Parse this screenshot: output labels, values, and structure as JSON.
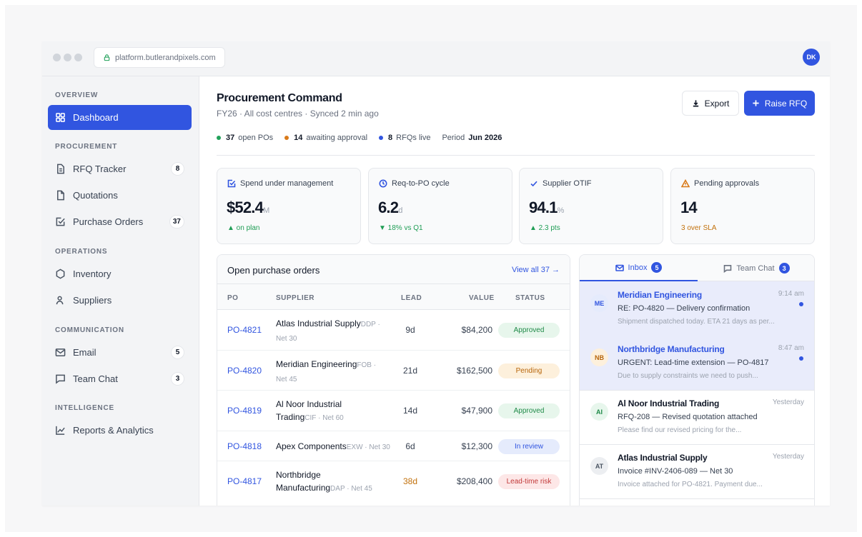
{
  "browser": {
    "url": "platform.butlerandpixels.com",
    "user_initials": "DK"
  },
  "sidebar": {
    "sections": {
      "overview": "OVERVIEW",
      "procurement": "PROCUREMENT",
      "operations": "OPERATIONS",
      "communication": "COMMUNICATION",
      "intelligence": "INTELLIGENCE"
    },
    "items": [
      {
        "label": "Dashboard",
        "icon": "grid-icon",
        "active": true
      },
      {
        "label": "RFQ Tracker",
        "icon": "file-list-icon",
        "badge": "8"
      },
      {
        "label": "Quotations",
        "icon": "document-icon"
      },
      {
        "label": "Purchase Orders",
        "icon": "checkbox-icon",
        "badge": "37"
      },
      {
        "label": "Inventory",
        "icon": "hexagon-icon"
      },
      {
        "label": "Suppliers",
        "icon": "user-icon"
      },
      {
        "label": "Email",
        "icon": "mail-icon",
        "badge": "5"
      },
      {
        "label": "Team Chat",
        "icon": "chat-icon",
        "badge": "3"
      },
      {
        "label": "Reports & Analytics",
        "icon": "chart-line-icon"
      }
    ]
  },
  "header": {
    "title": "Procurement Command",
    "subtitle": "FY26 · All cost centres · Synced 2 min ago",
    "export_label": "Export",
    "raise_rfq_label": "Raise RFQ"
  },
  "stats": {
    "open_pos": {
      "value": "37",
      "label": "open POs",
      "color": "#22a15a"
    },
    "awaiting": {
      "value": "14",
      "label": "awaiting approval",
      "color": "#d97a1a"
    },
    "rfqs": {
      "value": "8",
      "label": "RFQs live",
      "color": "#3155e0"
    },
    "period_label": "Period",
    "period_value": "Jun 2026"
  },
  "kpis": [
    {
      "label": "Spend under management",
      "value": "$52.4",
      "unit": "M",
      "delta": "▲ on plan",
      "delta_color": "#1f9d55",
      "icon": "checkbox-icon"
    },
    {
      "label": "Req-to-PO cycle",
      "value": "6.2",
      "unit": "d",
      "delta": "▼ 18% vs Q1",
      "delta_color": "#1f9d55",
      "icon": "clock-icon"
    },
    {
      "label": "Supplier OTIF",
      "value": "94.1",
      "unit": "%",
      "delta": "▲ 2.3 pts",
      "delta_color": "#1f9d55",
      "icon": "check-icon"
    },
    {
      "label": "Pending approvals",
      "value": "14",
      "unit": "",
      "delta": "3 over SLA",
      "delta_color": "#c2710c",
      "icon": "warning-icon"
    }
  ],
  "purchase_orders": {
    "title": "Open purchase orders",
    "view_all": "View all 37 →",
    "columns": [
      "PO",
      "SUPPLIER",
      "LEAD",
      "VALUE",
      "STATUS"
    ],
    "rows": [
      {
        "id": "PO-4821",
        "supplier": "Atlas Industrial Supply",
        "terms": "DDP · Net 30",
        "lead": "9d",
        "value": "$84,200",
        "status": "Approved"
      },
      {
        "id": "PO-4820",
        "supplier": "Meridian Engineering",
        "terms": "FOB · Net 45",
        "lead": "21d",
        "value": "$162,500",
        "status": "Pending"
      },
      {
        "id": "PO-4819",
        "supplier": "Al Noor Industrial Trading",
        "terms": "CIF · Net 60",
        "lead": "14d",
        "value": "$47,900",
        "status": "Approved"
      },
      {
        "id": "PO-4818",
        "supplier": "Apex Components",
        "terms": "EXW · Net 30",
        "lead": "6d",
        "value": "$12,300",
        "status": "In review"
      },
      {
        "id": "PO-4817",
        "supplier": "Northbridge Manufacturing",
        "terms": "DAP · Net 45",
        "lead": "38d",
        "value": "$208,400",
        "status": "Lead-time risk"
      }
    ]
  },
  "inbox": {
    "tab_inbox": "Inbox",
    "tab_inbox_count": "5",
    "tab_chat": "Team Chat",
    "tab_chat_count": "3",
    "messages": [
      {
        "initials": "ME",
        "from": "Meridian Engineering",
        "time": "9:14 am",
        "subject": "RE: PO-4820 — Delivery confirmation",
        "preview": "Shipment dispatched today. ETA 21 days as per...",
        "unread": true
      },
      {
        "initials": "NB",
        "from": "Northbridge Manufacturing",
        "time": "8:47 am",
        "subject": "URGENT: Lead-time extension — PO-4817",
        "preview": "Due to supply constraints we need to push...",
        "unread": true
      },
      {
        "initials": "AI",
        "from": "Al Noor Industrial Trading",
        "time": "Yesterday",
        "subject": "RFQ-208 — Revised quotation attached",
        "preview": "Please find our revised pricing for the...",
        "unread": false
      },
      {
        "initials": "AT",
        "from": "Atlas Industrial Supply",
        "time": "Yesterday",
        "subject": "Invoice #INV-2406-089 — Net 30",
        "preview": "Invoice attached for PO-4821. Payment due...",
        "unread": false
      }
    ]
  },
  "colors": {
    "accent": "#3155e0"
  }
}
